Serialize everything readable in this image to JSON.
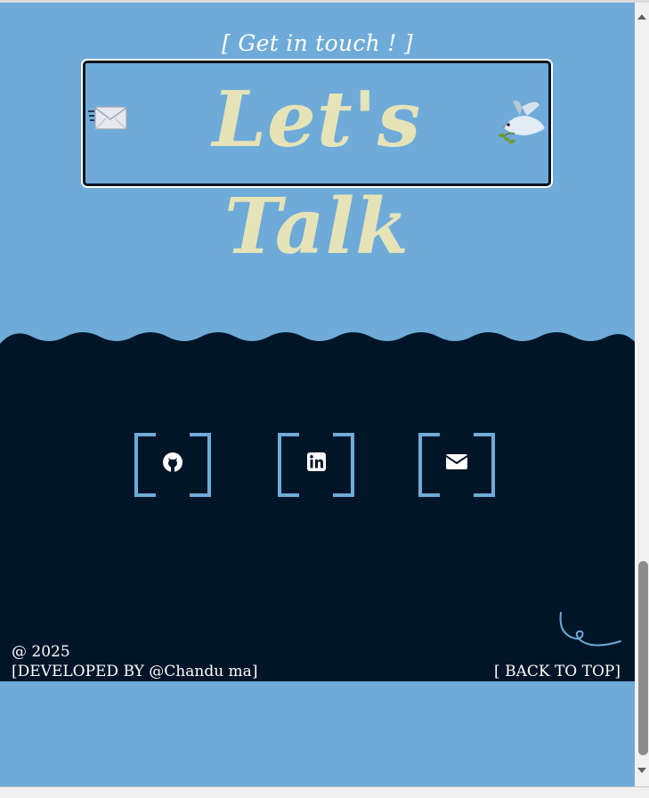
{
  "hero": {
    "subtitle": "[ Get in touch ! ]",
    "title": "Let's Talk"
  },
  "socials": [
    {
      "name": "github",
      "icon": "github-icon"
    },
    {
      "name": "linkedin",
      "icon": "linkedin-icon"
    },
    {
      "name": "email",
      "icon": "mail-icon"
    }
  ],
  "footer": {
    "copyright": "@ 2025",
    "developed_by": "[DEVELOPED BY @Chandu ma]",
    "back_to_top": "[ BACK TO TOP]"
  },
  "colors": {
    "sky": "#6eabd8",
    "navy": "#011528",
    "title_cream": "#e6e3b8"
  }
}
